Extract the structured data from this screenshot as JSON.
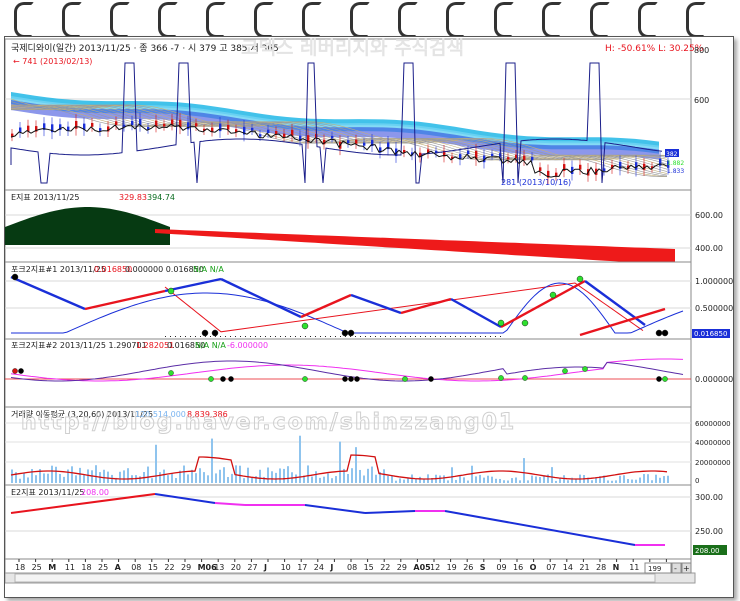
{
  "watermark_title": "코덱스 레버리지와 주식검색",
  "watermark_url": "http://blog.naver.com/shinzzang01",
  "panel1": {
    "header": "국제디와이(일간) 2013/11/25 · 종 366 -7 · 시 379 고 385 저 365",
    "hi_lo": "H: -50.61%  L: 30.25%",
    "high_note": "← 741 (2013/02/13)",
    "low_note": "281 (2013/10/16)",
    "axis": [
      "800",
      "600"
    ],
    "price_tags": [
      "382",
      "1.882",
      "1.833"
    ]
  },
  "panel2": {
    "header_name": "E지표 2013/11/25",
    "v1": "329.83",
    "v2": "394.74",
    "axis": [
      "600.00",
      "400.00"
    ]
  },
  "panel3": {
    "header_name": "포크2지표#1 2013/11/25",
    "v1": "0.016850",
    "v2": "0.000000 0.016850",
    "na": "N/A N/A",
    "axis": [
      "1.000000",
      "0.500000"
    ],
    "tag": "0.016850"
  },
  "panel4": {
    "header_name": "포크2지표#2 2013/11/25 1.290701",
    "v1": "1.282051",
    "v2": "0.016850",
    "na": "N/A N/A",
    "v3": "-6.000000",
    "axis": [
      "0.000000"
    ]
  },
  "panel5": {
    "header_name": "거래량 이동평균 (3,20,60) 2013/11/25",
    "v1": "120,514,000",
    "v2": "8,839,386",
    "axis": [
      "60000000",
      "40000000",
      "20000000",
      "0"
    ]
  },
  "panel6": {
    "header_name": "E2지표 2013/11/25",
    "v1": "208.00",
    "axis": [
      "300.00",
      "250.00"
    ],
    "tag": "208.00"
  },
  "xaxis": {
    "labels": [
      "18",
      "25",
      "M",
      "11",
      "18",
      "25",
      "A",
      "08",
      "15",
      "22",
      "29",
      "M06",
      "13",
      "20",
      "27",
      "J",
      "10",
      "17",
      "24",
      "J",
      "08",
      "15",
      "22",
      "29",
      "A05",
      "12",
      "19",
      "26",
      "S",
      "09",
      "16",
      "O",
      "07",
      "14",
      "21",
      "28",
      "N",
      "11",
      "18",
      "25"
    ],
    "zoom": "199"
  },
  "colors": {
    "blue": "#1a2fd8",
    "red": "#e8141e",
    "green": "#2ee02e",
    "magenta": "#f030f0",
    "navy": "#1b1f8a",
    "cyan": "#21b7e6"
  }
}
